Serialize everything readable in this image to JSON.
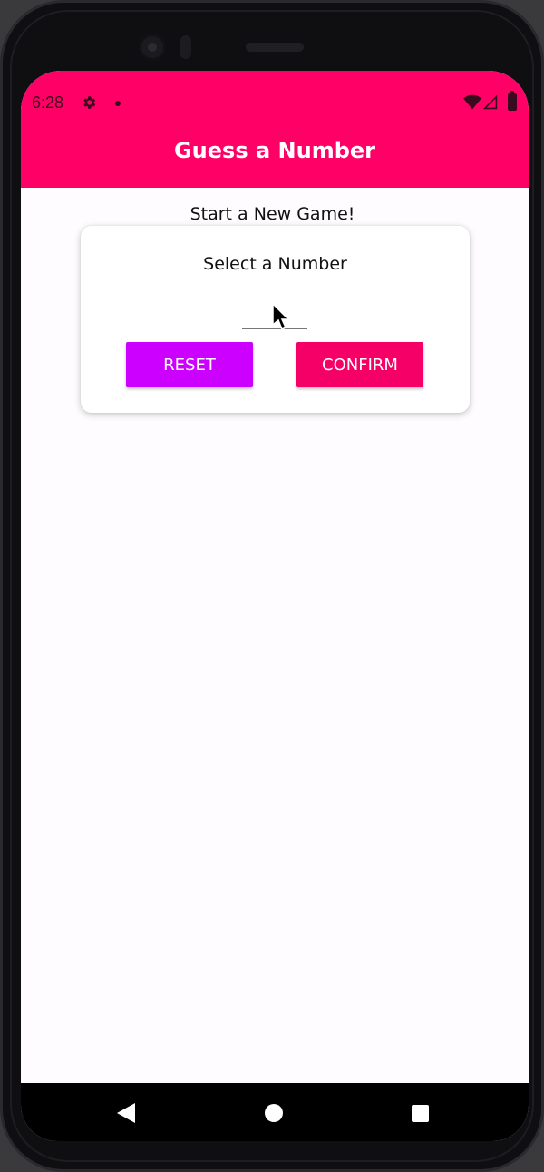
{
  "status_bar": {
    "time": "6:28"
  },
  "app_bar": {
    "title": "Guess a Number",
    "color": "#ff0066"
  },
  "screen": {
    "subtitle": "Start a New Game!",
    "card": {
      "title": "Select a Number",
      "number_input": {
        "value": "",
        "placeholder": ""
      },
      "buttons": {
        "reset_label": "RESET",
        "confirm_label": "CONFIRM"
      }
    }
  },
  "colors": {
    "reset_button": "#cc00ff",
    "confirm_button": "#f50067",
    "background": "#fefcfe"
  },
  "icons": {
    "status": [
      "gear-icon",
      "dot-icon",
      "wifi-icon",
      "signal-icon",
      "battery-icon"
    ],
    "navigation": [
      "back-icon",
      "home-icon",
      "recent-apps-icon"
    ]
  }
}
